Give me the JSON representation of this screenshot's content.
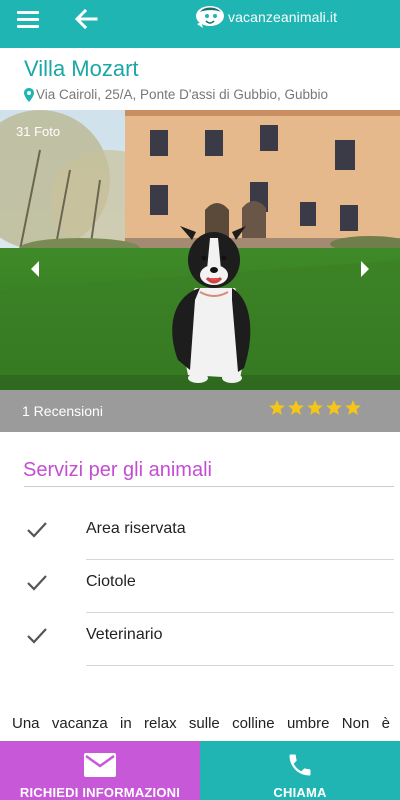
{
  "header": {
    "logo_text": "vacanzeanimali.it",
    "bg_color": "#1fb5b3"
  },
  "listing": {
    "title": "Villa Mozart",
    "address": "Via Cairoli, 25/A, Ponte D'assi di Gubbio, Gubbio"
  },
  "gallery": {
    "photo_count": "31 Foto"
  },
  "reviews": {
    "label": "1 Recensioni",
    "rating": 5,
    "star_color": "#f5c518"
  },
  "services": {
    "title": "Servizi per gli animali",
    "items": [
      {
        "label": "Area riservata"
      },
      {
        "label": "Ciotole"
      },
      {
        "label": "Veterinario"
      }
    ]
  },
  "description": {
    "text": "Una vacanza in relax sulle colline umbre Non è"
  },
  "actions": {
    "info_label": "RICHIEDI INFORMAZIONI",
    "info_color": "#c759d8",
    "call_label": "CHIAMA",
    "call_color": "#20b5b3"
  }
}
